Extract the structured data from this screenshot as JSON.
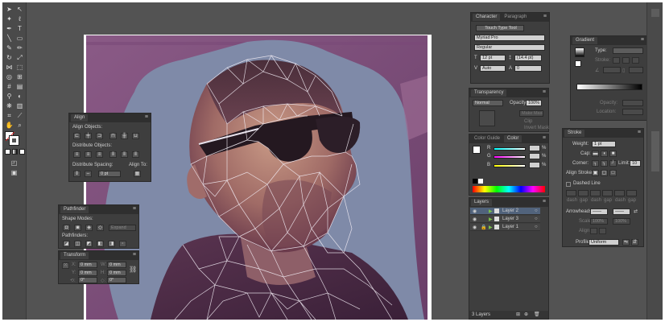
{
  "toolbar": {
    "tools": [
      "selection-tool",
      "direct-selection-tool",
      "magic-wand-tool",
      "lasso-tool",
      "pen-tool",
      "type-tool",
      "line-tool",
      "rectangle-tool",
      "paintbrush-tool",
      "pencil-tool",
      "rotate-tool",
      "scale-tool",
      "width-tool",
      "free-transform-tool",
      "shape-builder-tool",
      "perspective-tool",
      "mesh-tool",
      "gradient-tool",
      "eyedropper-tool",
      "blend-tool",
      "symbol-sprayer-tool",
      "graph-tool",
      "artboard-tool",
      "slice-tool",
      "eraser-tool",
      "hand-tool",
      "zoom-tool"
    ]
  },
  "character_panel": {
    "tabs": [
      "Character",
      "Paragraph"
    ],
    "touch_type_button": "Touch Type Tool",
    "font_family": "Myriad Pro",
    "font_style": "Regular",
    "font_size": "12 pt",
    "leading": "(14.4 pt)",
    "kerning": "Auto",
    "tracking": "0"
  },
  "gradient_panel": {
    "tabs": [
      "Gradient"
    ],
    "type_label": "Type:",
    "stroke_label": "Stroke:",
    "opacity_label": "Opacity:",
    "location_label": "Location:"
  },
  "transparency_panel": {
    "tabs": [
      "Transparency"
    ],
    "blend_mode": "Normal",
    "opacity_label": "Opacity:",
    "opacity_value": "100%",
    "make_mask": "Make Mask",
    "clip": "Clip",
    "invert_mask": "Invert Mask"
  },
  "color_panel": {
    "tabs": [
      "Color Guide",
      "Color"
    ],
    "channels": [
      "R",
      "G",
      "B"
    ],
    "percent": "%"
  },
  "layers_panel": {
    "tabs": [
      "Layers"
    ],
    "layers": [
      "Layer 2",
      "Layer 3",
      "Layer 1"
    ],
    "footer_count": "3 Layers"
  },
  "stroke_panel": {
    "tabs": [
      "Stroke"
    ],
    "weight_label": "Weight:",
    "weight_value": "1 pt",
    "cap_label": "Cap:",
    "corner_label": "Corner:",
    "limit_label": "Limit:",
    "limit_value": "10",
    "align_label": "Align Stroke:",
    "dashed_line": "Dashed Line",
    "dash_labels": [
      "dash",
      "gap",
      "dash",
      "gap",
      "dash",
      "gap"
    ],
    "arrowheads_label": "Arrowheads:",
    "scale_label": "Scale:",
    "scale_values": [
      "100%",
      "100%"
    ],
    "align_arrow_label": "Align:",
    "profile_label": "Profile:",
    "profile_value": "Uniform"
  },
  "align_panel": {
    "tabs": [
      "Align"
    ],
    "align_objects": "Align Objects:",
    "distribute_objects": "Distribute Objects:",
    "distribute_spacing": "Distribute Spacing:",
    "align_to": "Align To:",
    "spacing_value": "0 pt"
  },
  "pathfinder_panel": {
    "tabs": [
      "Pathfinder"
    ],
    "shape_modes": "Shape Modes:",
    "expand_button": "Expand",
    "pathfinders": "Pathfinders:"
  },
  "transform_panel": {
    "tabs": [
      "Transform"
    ],
    "x_label": "X:",
    "y_label": "Y:",
    "w_label": "W:",
    "h_label": "H:",
    "rot_label": "⟲:",
    "shear_label": "◇:",
    "x_value": "0 mm",
    "y_value": "0 mm",
    "w_value": "0 mm",
    "h_value": "0 mm",
    "rot_value": "0°",
    "shear_value": "0°"
  }
}
